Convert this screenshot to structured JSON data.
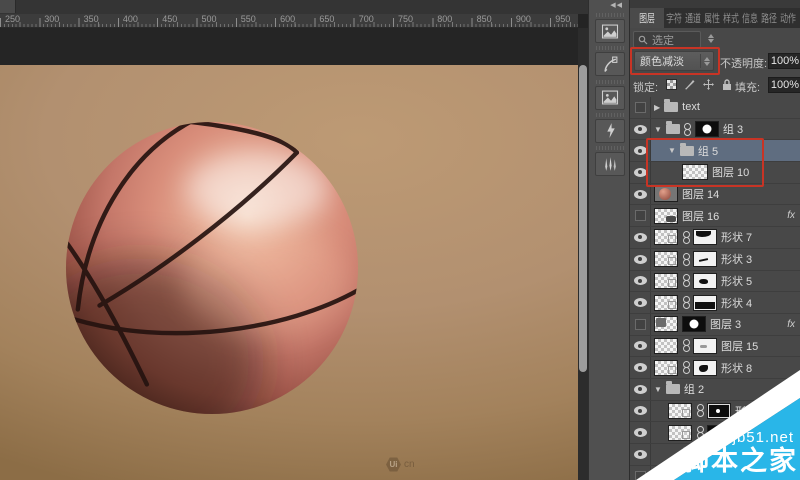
{
  "icons": {
    "collapse_chevrons": "◀◀",
    "expanded_arrow": "▼",
    "collapsed_arrow": "▶",
    "fx_label": "fx"
  },
  "colors": {
    "annotation_red": "#c83425",
    "selected_row_blue": "#5f6d80",
    "watermark_cyan": "#29b6e8",
    "canvas_tan": "#b29070"
  },
  "ruler": {
    "unit_labels": [
      "250",
      "300",
      "350",
      "400",
      "450",
      "500",
      "550",
      "600",
      "650",
      "700",
      "750",
      "800",
      "850",
      "900",
      "950"
    ]
  },
  "canvas": {
    "watermark_badge": "Ui",
    "watermark_suffix": "cn"
  },
  "dock": {
    "panels": [
      {
        "icon": "library-panel-icon"
      },
      {
        "icon": "brush-presets-panel-icon"
      },
      {
        "icon": "styles-panel-icon"
      },
      {
        "icon": "actions-panel-icon"
      },
      {
        "icon": "brush-panel-icon"
      }
    ]
  },
  "layers_panel": {
    "tabs": [
      {
        "label": "图层",
        "active": true
      },
      {
        "label": "字符",
        "active": false
      },
      {
        "label": "通道",
        "active": false
      },
      {
        "label": "属性",
        "active": false
      },
      {
        "label": "样式",
        "active": false
      },
      {
        "label": "信息",
        "active": false
      },
      {
        "label": "路径",
        "active": false
      },
      {
        "label": "动作",
        "active": false
      }
    ],
    "filter_label": "选定",
    "blend_mode_value": "颜色减淡",
    "opacity_label": "不透明度:",
    "opacity_value": "100%",
    "lock_label": "锁定:",
    "fill_label": "填充:",
    "fill_value": "100%",
    "layers": [
      {
        "label": "text",
        "eye": "empty",
        "arrow": "right",
        "group": true,
        "indent": 0
      },
      {
        "label": "组 3",
        "eye": true,
        "arrow": "down",
        "group": true,
        "chain": true,
        "thumbs": [
          "black+wcircle"
        ],
        "indent": 0
      },
      {
        "label": "组 5",
        "eye": true,
        "arrow": "down",
        "group": true,
        "indent": 1,
        "selected": true
      },
      {
        "label": "图层 10",
        "eye": true,
        "thumbs": [
          "checker26"
        ],
        "indent": 2
      },
      {
        "label": "图层 14",
        "eye": true,
        "thumbs": [
          "gray+ball"
        ],
        "indent": 0
      },
      {
        "label": "图层 16",
        "eye": "empty",
        "thumbs": [
          "checker+smudge"
        ],
        "indent": 0,
        "fx": true
      },
      {
        "label": "形状 7",
        "eye": true,
        "thumbs": [
          "checker+vframe",
          "chain",
          "white+blob"
        ],
        "indent": 0
      },
      {
        "label": "形状 3",
        "eye": true,
        "thumbs": [
          "checker+vframe",
          "chain",
          "white+dash"
        ],
        "indent": 0
      },
      {
        "label": "形状 5",
        "eye": true,
        "thumbs": [
          "checker+vframe",
          "chain",
          "white+blob2"
        ],
        "indent": 0
      },
      {
        "label": "形状 4",
        "eye": true,
        "thumbs": [
          "checker+vframe",
          "chain",
          "white+half"
        ],
        "indent": 0
      },
      {
        "label": "图层 3",
        "eye": "empty",
        "thumbs": [
          "checker+patch",
          "black+wcircle"
        ],
        "indent": 0,
        "fx": true
      },
      {
        "label": "图层 15",
        "eye": true,
        "thumbs": [
          "checker",
          "chain",
          "white+dash2"
        ],
        "indent": 0
      },
      {
        "label": "形状 8",
        "eye": true,
        "thumbs": [
          "checker+vframe",
          "chain",
          "white+crescent"
        ],
        "indent": 0
      },
      {
        "label": "组 2",
        "eye": true,
        "arrow": "down",
        "group": true,
        "indent": 0
      },
      {
        "label": "形状 6",
        "eye": true,
        "thumbs": [
          "checker+vframe",
          "chain",
          "black+wdot+brackets"
        ],
        "indent": 1
      },
      {
        "label": "",
        "eye": true,
        "thumbs": [
          "checker+vframe",
          "chain",
          "black+wdot"
        ],
        "indent": 1
      },
      {
        "label": "",
        "eye": true,
        "thumbs": [],
        "indent": 0
      },
      {
        "label": "",
        "eye": "empty",
        "thumbs": [],
        "indent": 0
      }
    ]
  },
  "site_watermark": {
    "line1": "jb51.net",
    "line2": "脚本之家"
  }
}
